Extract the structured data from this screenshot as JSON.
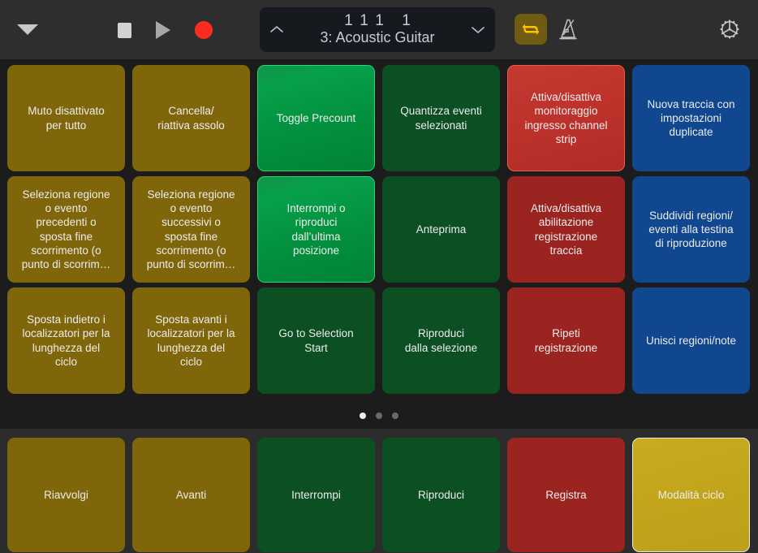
{
  "toolbar": {
    "menu_icon": "chevron-down-triangle-icon",
    "stop_label": "Stop",
    "play_label": "Play",
    "record_label": "Record",
    "lcd": {
      "prev_icon": "chevron-up-icon",
      "next_icon": "chevron-down-icon",
      "position": [
        "1",
        "1",
        "1",
        "1"
      ],
      "track": "3: Acoustic Guitar"
    },
    "cycle_label": "Cycle",
    "cycle_active": true,
    "cycle_accent": "#ffc400",
    "metronome_label": "Metronome",
    "settings_label": "Settings"
  },
  "grid": {
    "pads": [
      {
        "label": "Muto disattivato\nper tutto",
        "color": "yellow",
        "active": false
      },
      {
        "label": "Cancella/\nriattiva assolo",
        "color": "yellow",
        "active": false
      },
      {
        "label": "Toggle Precount",
        "color": "green",
        "active": true
      },
      {
        "label": "Quantizza eventi\nselezionati",
        "color": "green",
        "active": false
      },
      {
        "label": "Attiva/disattiva\nmonitoraggio\ningresso channel\nstrip",
        "color": "red",
        "active": true
      },
      {
        "label": "Nuova traccia con\nimpostazioni\nduplicate",
        "color": "blue",
        "active": false
      },
      {
        "label": "Seleziona regione\no evento\nprecedenti o\nsposta fine\nscorrimento (o\npunto di scorrim…",
        "color": "yellow",
        "active": false
      },
      {
        "label": "Seleziona regione\no evento\nsuccessivi o\nsposta fine\nscorrimento (o\npunto di scorrim…",
        "color": "yellow",
        "active": false
      },
      {
        "label": "Interrompi o\nriproduci\ndall’ultima\nposizione",
        "color": "green",
        "active": true
      },
      {
        "label": "Anteprima",
        "color": "green",
        "active": false
      },
      {
        "label": "Attiva/disattiva\nabilitazione\nregistrazione\ntraccia",
        "color": "red",
        "active": false
      },
      {
        "label": "Suddividi regioni/\neventi alla testina\ndi riproduzione",
        "color": "blue",
        "active": false
      },
      {
        "label": "Sposta indietro i\nlocalizzatori per la\nlunghezza del\nciclo",
        "color": "yellow",
        "active": false
      },
      {
        "label": "Sposta avanti i\nlocalizzatori per la\nlunghezza del\nciclo",
        "color": "yellow",
        "active": false
      },
      {
        "label": "Go to Selection\nStart",
        "color": "green",
        "active": false
      },
      {
        "label": "Riproduci\ndalla selezione",
        "color": "green",
        "active": false
      },
      {
        "label": "Ripeti\nregistrazione",
        "color": "red",
        "active": false
      },
      {
        "label": "Unisci regioni/note",
        "color": "blue",
        "active": false
      }
    ],
    "page_count": 3,
    "page_active_index": 0
  },
  "transport": {
    "pads": [
      {
        "label": "Riavvolgi",
        "color": "yellow",
        "active": false
      },
      {
        "label": "Avanti",
        "color": "yellow",
        "active": false
      },
      {
        "label": "Interrompi",
        "color": "green",
        "active": false
      },
      {
        "label": "Riproduci",
        "color": "green",
        "active": false
      },
      {
        "label": "Registra",
        "color": "red",
        "active": false
      },
      {
        "label": "Modalità ciclo",
        "color": "yellow",
        "active": true
      }
    ]
  }
}
